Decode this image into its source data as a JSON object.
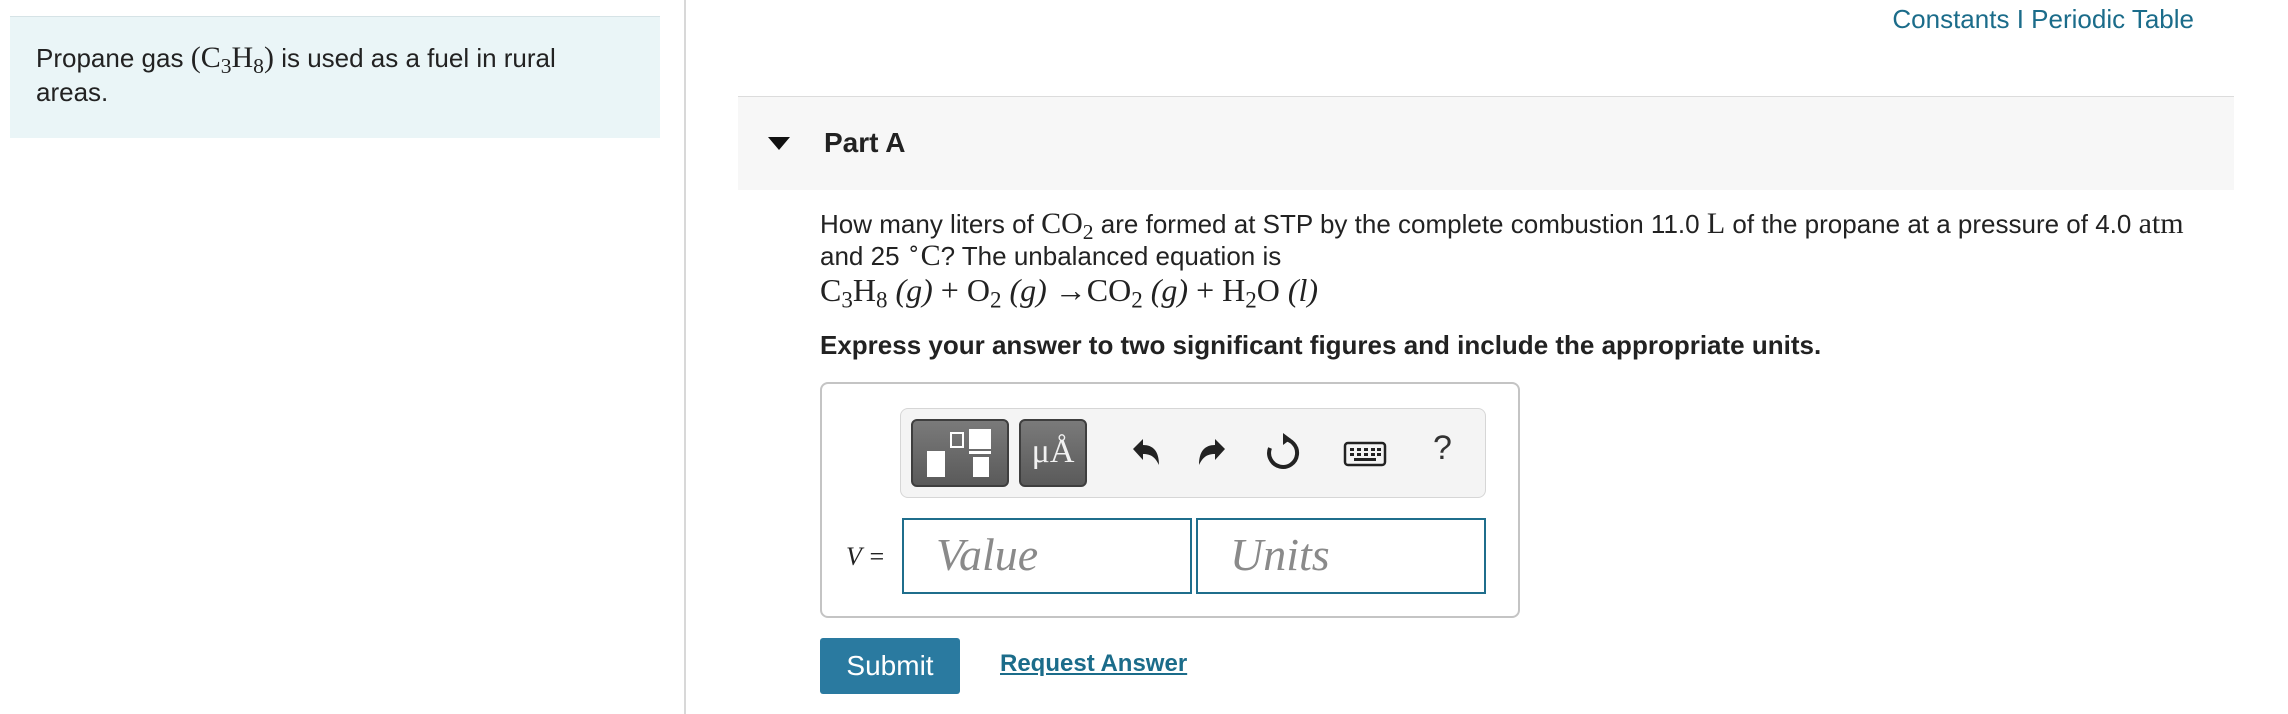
{
  "left_panel": {
    "intro_prefix": "Propane gas",
    "formula_c": "C",
    "formula_3": "3",
    "formula_h": "H",
    "formula_8": "8",
    "intro_suffix": "is used as a fuel in rural areas."
  },
  "top_links": {
    "constants": "Constants",
    "separator": "I",
    "periodic_table": "Periodic Table"
  },
  "part": {
    "title": "Part A"
  },
  "question": {
    "text_1": "How many liters of",
    "co2_c": "CO",
    "co2_2": "2",
    "text_2": "are formed at STP by the complete combustion 11.0",
    "unit_l": "L",
    "text_3": "of the propane at a pressure of 4.0",
    "unit_atm": "atm",
    "text_4": "and 25",
    "degree": "∘",
    "unit_c": "C",
    "text_5": "? The unbalanced equation is"
  },
  "equation": {
    "c3h8_c": "C",
    "c3h8_3": "3",
    "c3h8_h": "H",
    "c3h8_8": "8",
    "state_g1": "(g)",
    "plus1": "+",
    "o2_o": "O",
    "o2_2": "2",
    "state_g2": "(g)",
    "arrow": "→",
    "co2_c": "CO",
    "co2_2": "2",
    "state_g3": "(g)",
    "plus2": "+",
    "h2o_h": "H",
    "h2o_2": "2",
    "h2o_o": "O",
    "state_l": "(l)"
  },
  "instruction": "Express your answer to two significant figures and include the appropriate units.",
  "answer": {
    "variable_label": "V =",
    "value_placeholder": "Value",
    "units_placeholder": "Units"
  },
  "toolbar": {
    "units_label": "μÅ",
    "help_label": "?",
    "icons": [
      "templates-icon",
      "units-icon",
      "undo-icon",
      "redo-icon",
      "reset-icon",
      "keyboard-icon",
      "help-icon"
    ]
  },
  "buttons": {
    "submit": "Submit",
    "request_answer": "Request Answer"
  },
  "colors": {
    "accent": "#2a7aa0",
    "link": "#1b6c8a",
    "intro_bg": "#eaf5f7",
    "header_bg": "#f7f7f7"
  }
}
